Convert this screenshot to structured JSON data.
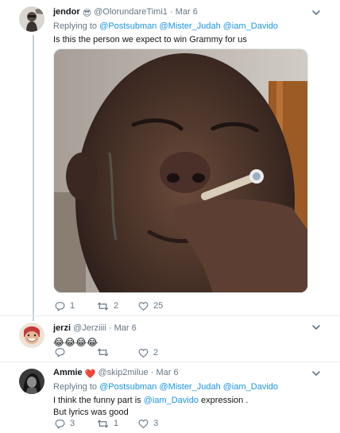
{
  "tweets": [
    {
      "name": "jendor",
      "emoji": "😎",
      "handle": "@OlorundareTimi1",
      "date": "Mar 6",
      "replying_to_label": "Replying to",
      "replying_to": [
        "@Postsubman",
        "@Mister_Judah",
        "@iam_Davido"
      ],
      "text": "Is this the person we expect to win Grammy for us",
      "actions": {
        "replies": "1",
        "retweets": "2",
        "likes": "25"
      }
    },
    {
      "name": "jerzi",
      "handle": "@Jerziiii",
      "date": "Mar 6",
      "text": "😂😂😂😂",
      "actions": {
        "replies": "",
        "retweets": "",
        "likes": "2"
      }
    },
    {
      "name": "Ammie",
      "emoji": "❤️",
      "handle": "@skip2milue",
      "date": "Mar 6",
      "replying_to_label": "Replying to",
      "replying_to": [
        "@Postsubman",
        "@Mister_Judah",
        "@iam_Davido"
      ],
      "text_before": "I think the funny part is",
      "text_mention": "@iam_Davido",
      "text_after": "expression .",
      "text_line2": "But lyrics was good",
      "actions": {
        "replies": "3",
        "retweets": "1",
        "likes": "3"
      }
    }
  ],
  "icons": {
    "reply": "reply-icon",
    "retweet": "retweet-icon",
    "like": "heart-icon",
    "more": "chevron-down-icon"
  },
  "colors": {
    "link": "#1b95e0",
    "muted": "#657786",
    "thread_line": "#c4cfd6"
  }
}
